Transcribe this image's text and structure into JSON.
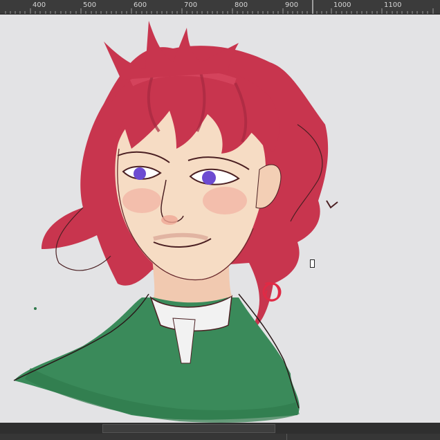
{
  "ruler": {
    "labels": [
      "400",
      "500",
      "600",
      "700",
      "800",
      "900",
      "1000",
      "1100"
    ]
  },
  "canvas": {
    "artwork": "character-illustration",
    "colors": {
      "hair": "#c8354e",
      "hair_shadow": "#a52a40",
      "skin": "#f6dcc4",
      "blush": "#f3b7a6",
      "eye": "#6c4bd1",
      "jacket": "#3a8a5a",
      "collar": "#f2f2f2",
      "earring": "#e02a45",
      "line": "#4a1f22",
      "background": "#e3e3e5"
    }
  },
  "scrollbar": {
    "orientation": "horizontal"
  },
  "status": {
    "text": ""
  }
}
